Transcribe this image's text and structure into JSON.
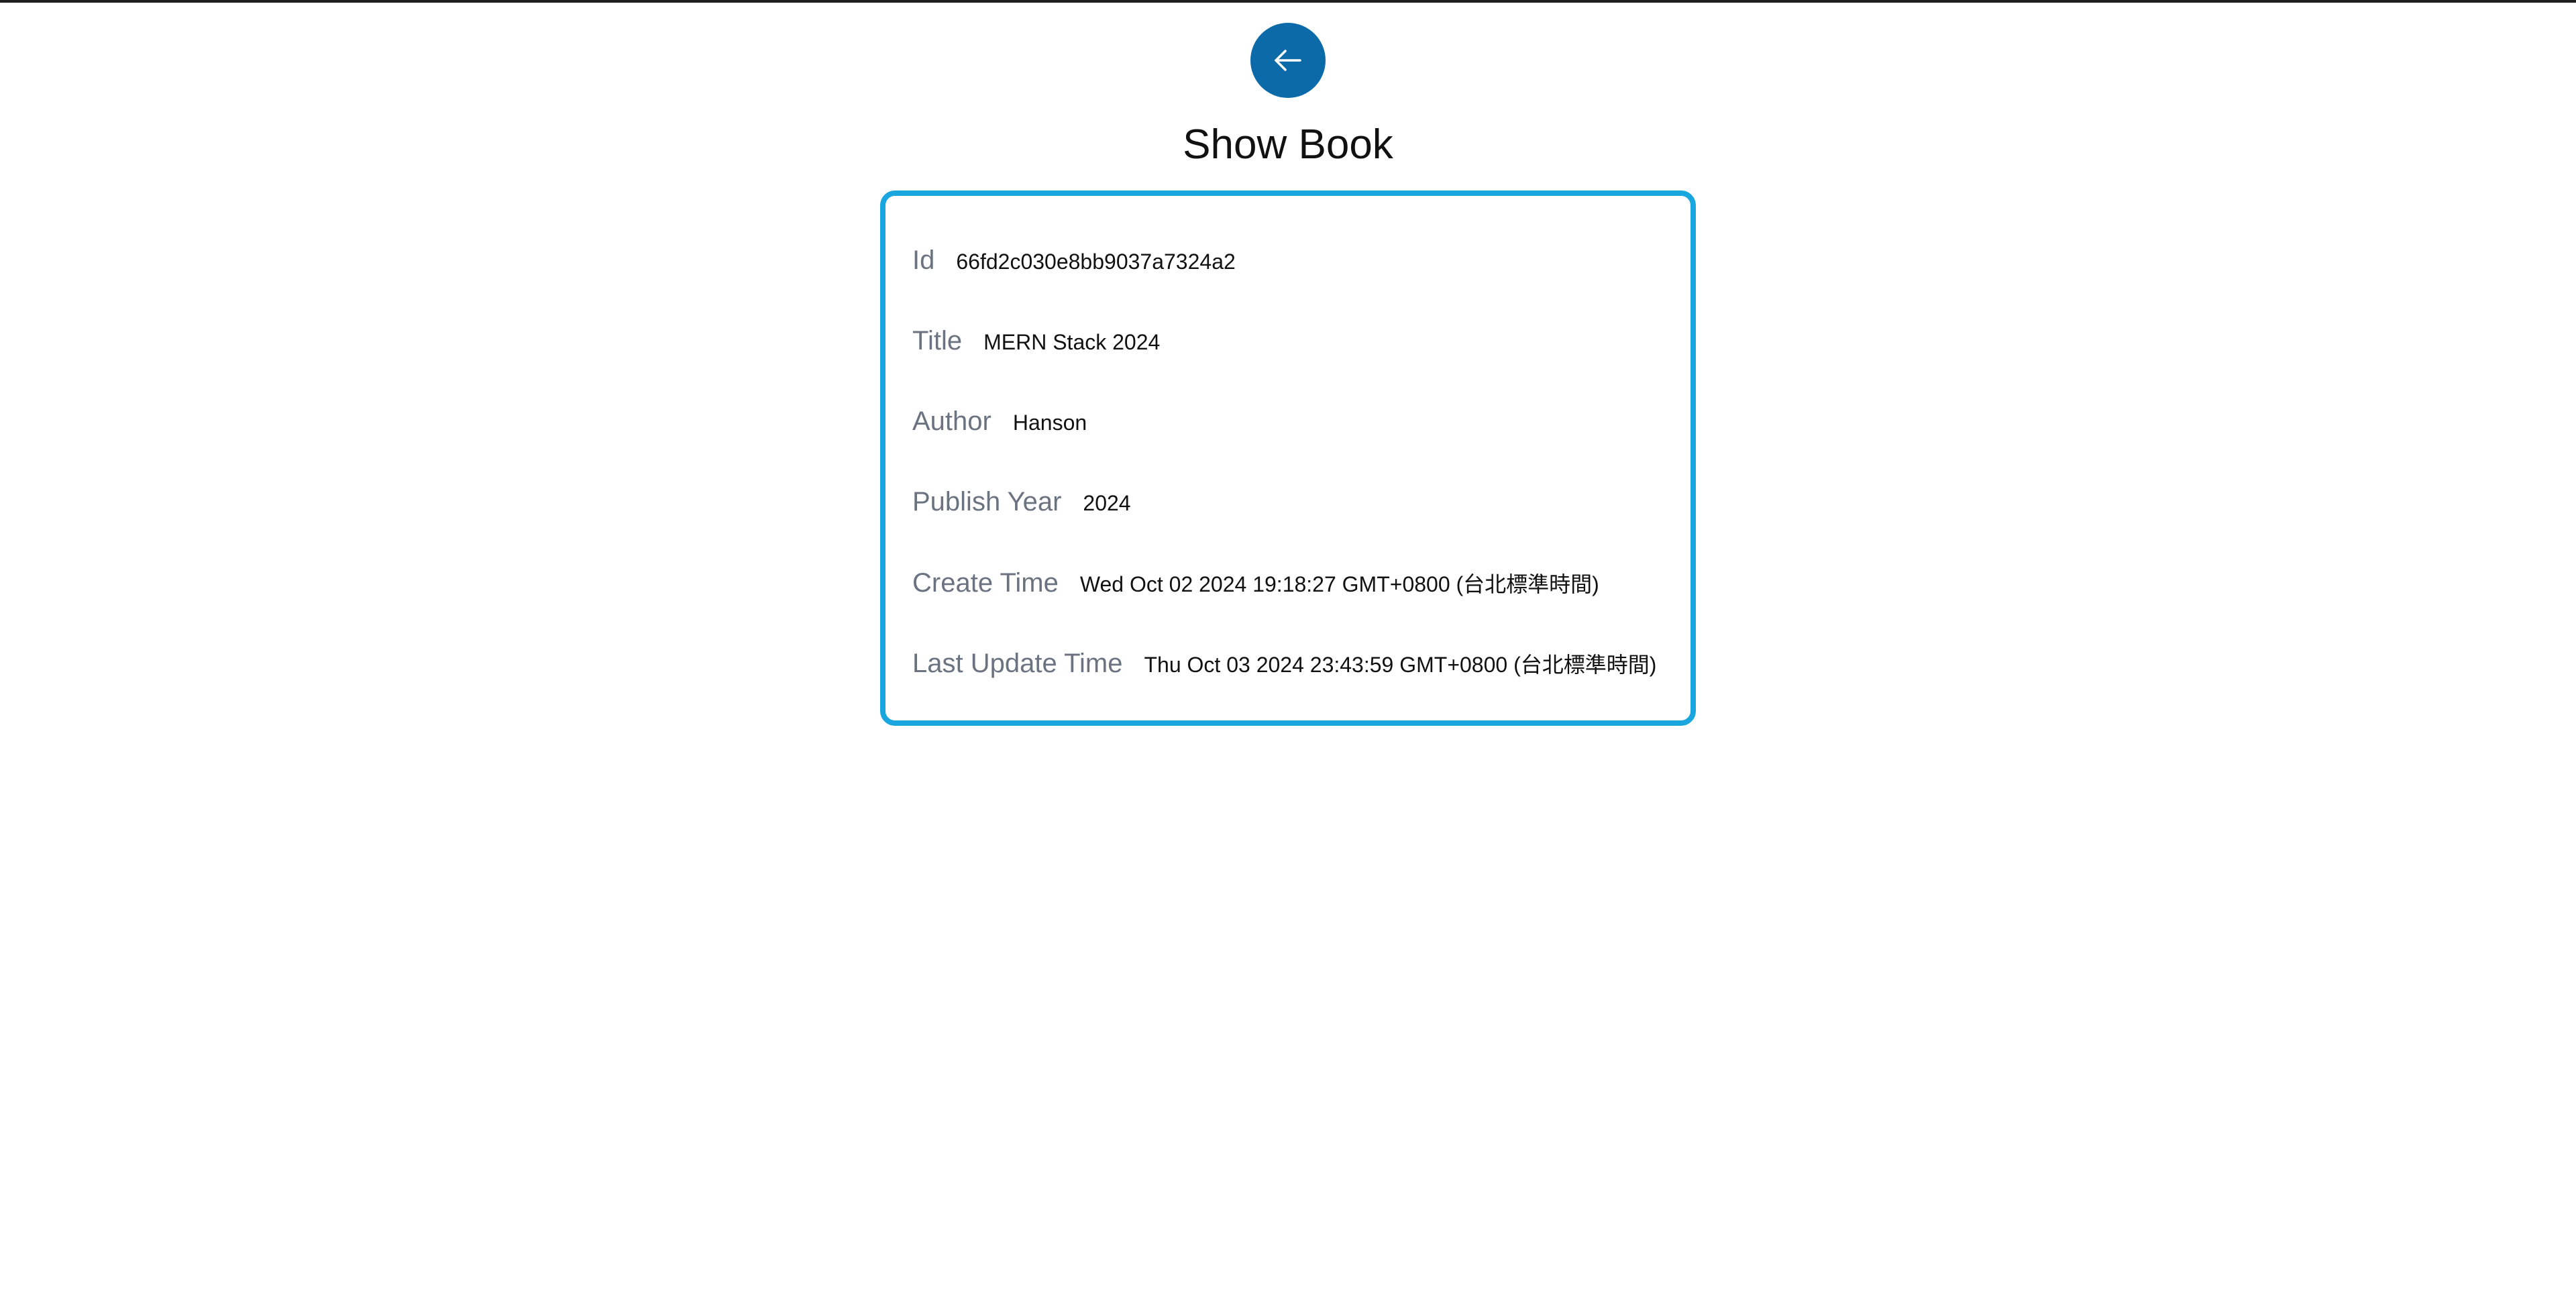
{
  "page": {
    "title": "Show Book",
    "back_button": {
      "icon": "arrow-left-icon",
      "color": "#0b6aa7"
    },
    "card_border_color": "#19a6df"
  },
  "book": {
    "fields": [
      {
        "label": "Id",
        "value": "66fd2c030e8bb9037a7324a2"
      },
      {
        "label": "Title",
        "value": "MERN Stack 2024"
      },
      {
        "label": "Author",
        "value": "Hanson"
      },
      {
        "label": "Publish Year",
        "value": "2024"
      },
      {
        "label": "Create Time",
        "value": "Wed Oct 02 2024 19:18:27 GMT+0800 (台北標準時間)"
      },
      {
        "label": "Last Update Time",
        "value": "Thu Oct 03 2024 23:43:59 GMT+0800 (台北標準時間)"
      }
    ]
  }
}
